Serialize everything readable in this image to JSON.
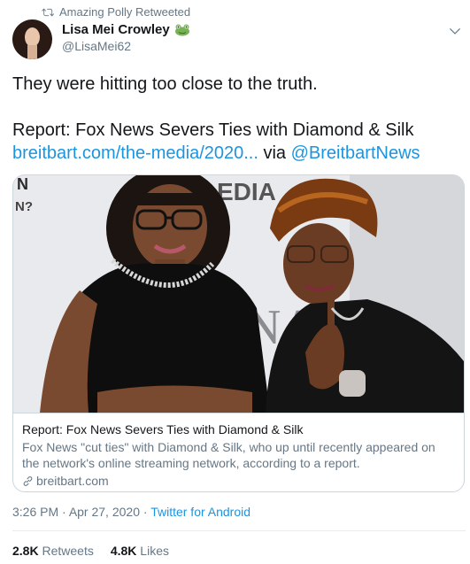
{
  "retweet": {
    "label": "Amazing Polly Retweeted",
    "icon": "retweet-icon"
  },
  "author": {
    "display_name": "Lisa Mei Crowley",
    "handle": "@LisaMei62",
    "emoji": "frog-emoji"
  },
  "tweet": {
    "line1": "They were hitting too close to the truth.",
    "line2": "Report: Fox News Severs Ties with Diamond & Silk",
    "link_text": "breitbart.com/the-media/2020...",
    "via_text": " via ",
    "mention": "@BreitbartNews"
  },
  "card": {
    "image_text_left": "N?",
    "image_text_top": "EDIA",
    "image_text_mid": "NA",
    "title": "Report: Fox News Severs Ties with Diamond & Silk",
    "description_line1": "Fox News \"cut ties\" with Diamond & Silk, who up until recently appeared on",
    "description_line2": "the network's online streaming network, according to a report.",
    "domain": "breitbart.com"
  },
  "meta": {
    "time": "3:26 PM",
    "separator1": " · ",
    "date": "Apr 27, 2020",
    "separator2": " · ",
    "source": "Twitter for Android"
  },
  "stats": {
    "retweets_count": "2.8K",
    "retweets_label": "Retweets",
    "likes_count": "4.8K",
    "likes_label": "Likes"
  },
  "colors": {
    "link": "#1b95e0",
    "secondary_text": "#657786",
    "primary_text": "#14171a",
    "border": "#ccd6dd"
  }
}
